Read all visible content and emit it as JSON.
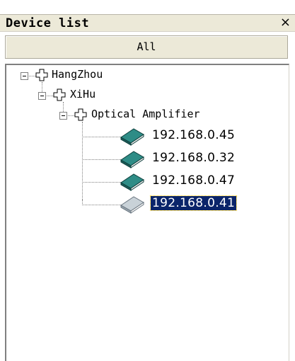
{
  "panel": {
    "title": "Device list",
    "close_label": "×",
    "filter_label": "All"
  },
  "tree": {
    "region": "HangZhou",
    "district": "XiHu",
    "group": "Optical Amplifier",
    "devices": [
      {
        "ip": "192.168.0.45",
        "status": "online"
      },
      {
        "ip": "192.168.0.32",
        "status": "online"
      },
      {
        "ip": "192.168.0.47",
        "status": "online"
      },
      {
        "ip": "192.168.0.41",
        "status": "offline",
        "selected": true
      }
    ]
  },
  "colors": {
    "selection_bg": "#0a246a",
    "online_book": "#1f6e6a",
    "offline_book": "#b8c4cc"
  }
}
